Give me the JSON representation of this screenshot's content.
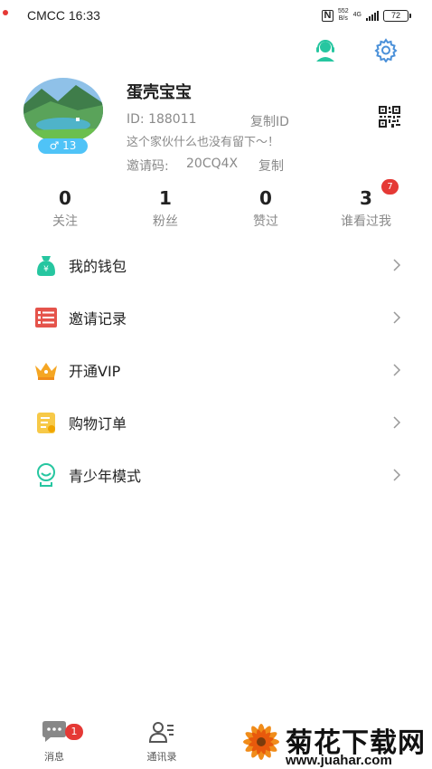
{
  "status_bar": {
    "carrier": "CMCC",
    "time": "16:33",
    "net_speed_value": "552",
    "net_speed_unit": "B/s",
    "net_type": "4G",
    "battery": "72"
  },
  "header": {
    "support_icon": "customer-service-icon",
    "settings_icon": "gear-icon"
  },
  "profile": {
    "nickname": "蛋壳宝宝",
    "id_text": "ID:  188011",
    "copy_id_label": "复制ID",
    "gender_symbol": "♂",
    "age": "13",
    "bio": "这个家伙什么也没有留下～！",
    "invite_label": "邀请码:",
    "invite_code": "20CQ4X",
    "copy_invite_label": "复制"
  },
  "stats": [
    {
      "value": "0",
      "label": "关注"
    },
    {
      "value": "1",
      "label": "粉丝"
    },
    {
      "value": "0",
      "label": "赞过"
    },
    {
      "value": "3",
      "label": "谁看过我",
      "badge": "7"
    }
  ],
  "menu": [
    {
      "label": "我的钱包",
      "icon": "wallet-icon"
    },
    {
      "label": "邀请记录",
      "icon": "list-icon"
    },
    {
      "label": "开通VIP",
      "icon": "crown-icon"
    },
    {
      "label": "购物订单",
      "icon": "order-icon"
    },
    {
      "label": "青少年模式",
      "icon": "teen-mode-icon"
    }
  ],
  "bottom_nav": {
    "messages_label": "消息",
    "messages_badge": "1",
    "contacts_label": "通讯录"
  },
  "watermark": {
    "title": "菊花下载网",
    "url": "www.juahar.com"
  },
  "colors": {
    "accent_teal": "#26c6a0",
    "accent_blue": "#4a90d9",
    "badge_red": "#e53935",
    "gender_blue": "#4fc3f7"
  }
}
